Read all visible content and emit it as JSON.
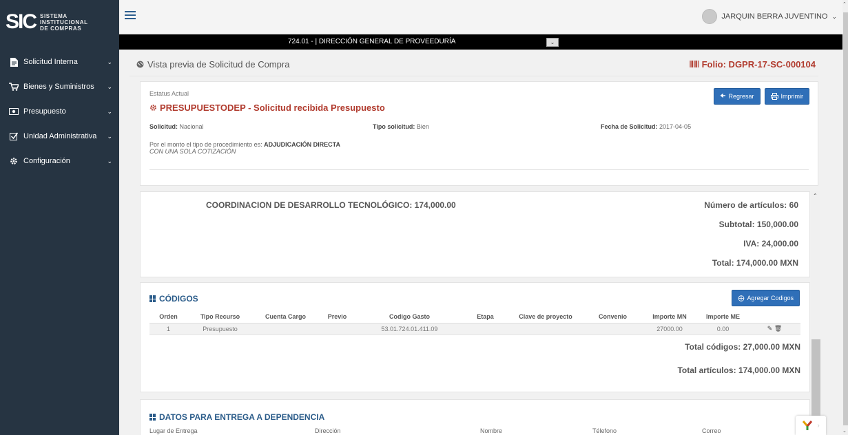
{
  "sidebar": {
    "logo_mark": "SIC",
    "logo_lines": [
      "SISTEMA",
      "INSTITUCIONAL",
      "DE COMPRAS"
    ],
    "items": [
      {
        "label": "Solicitud Interna",
        "icon": "file-icon"
      },
      {
        "label": "Bienes y Suministros",
        "icon": "cart-icon"
      },
      {
        "label": "Presupuesto",
        "icon": "money-icon"
      },
      {
        "label": "Unidad Administrativa",
        "icon": "checkbox-icon"
      },
      {
        "label": "Configuración",
        "icon": "gear-icon"
      }
    ]
  },
  "header": {
    "user_name": "JARQUIN BERRA JUVENTINO",
    "dependency": "724.01 - | DIRECCIÓN GENERAL DE PROVEEDURÍA"
  },
  "page": {
    "title": "Vista previa de Solicitud de Compra",
    "folio": "Folio: DGPR-17-SC-000104"
  },
  "status": {
    "label": "Estatus Actual",
    "title": "PRESUPUESTODEP - Solicitud recibida Presupuesto",
    "back_button": "Regresar",
    "print_button": "Imprimir",
    "solicitud_label": "Solicitud:",
    "solicitud_value": "Nacional",
    "tipo_label": "Tipo solicitud:",
    "tipo_value": "Bien",
    "fecha_label": "Fecha de Solicitud:",
    "fecha_value": "2017-04-05",
    "proc_text": "Por el monto el tipo de procedimiento es:",
    "proc_value": "ADJUDICACIÓN DIRECTA",
    "proc_note": "CON UNA SOLA COTIZACIÓN"
  },
  "totals": {
    "coordination": "COORDINACION DE DESARROLLO TECNOLÓGICO: 174,000.00",
    "num_articles": "Número de artículos: 60",
    "subtotal": "Subtotal: 150,000.00",
    "iva": "IVA: 24,000.00",
    "total": "Total: 174,000.00 MXN"
  },
  "codes": {
    "title": "CÓDIGOS",
    "add_button": "Agregar Codigos",
    "columns": [
      "Orden",
      "Tipo Recurso",
      "Cuenta Cargo",
      "Previo",
      "Codigo Gasto",
      "Etapa",
      "Clave de proyecto",
      "Convenio",
      "Importe MN",
      "Importe ME"
    ],
    "rows": [
      {
        "orden": "1",
        "tipo_recurso": "Presupuesto",
        "cuenta_cargo": "",
        "previo": "",
        "codigo_gasto": "53.01.724.01.411.09",
        "etapa": "",
        "clave_proyecto": "",
        "convenio": "",
        "importe_mn": "27000.00",
        "importe_me": "0.00"
      }
    ],
    "total_codes": "Total códigos: 27,000.00 MXN",
    "total_articles": "Total artículos: 174,000.00 MXN"
  },
  "delivery": {
    "title": "DATOS PARA ENTREGA A DEPENDENCIA",
    "columns": [
      "Lugar de Entrega",
      "Dirección",
      "Nombre",
      "Télefono",
      "Correo"
    ]
  },
  "colors": {
    "sidebar": "#263442",
    "accent": "#2f6fb8",
    "alert": "#b13b2e",
    "section": "#2b5c8a"
  }
}
